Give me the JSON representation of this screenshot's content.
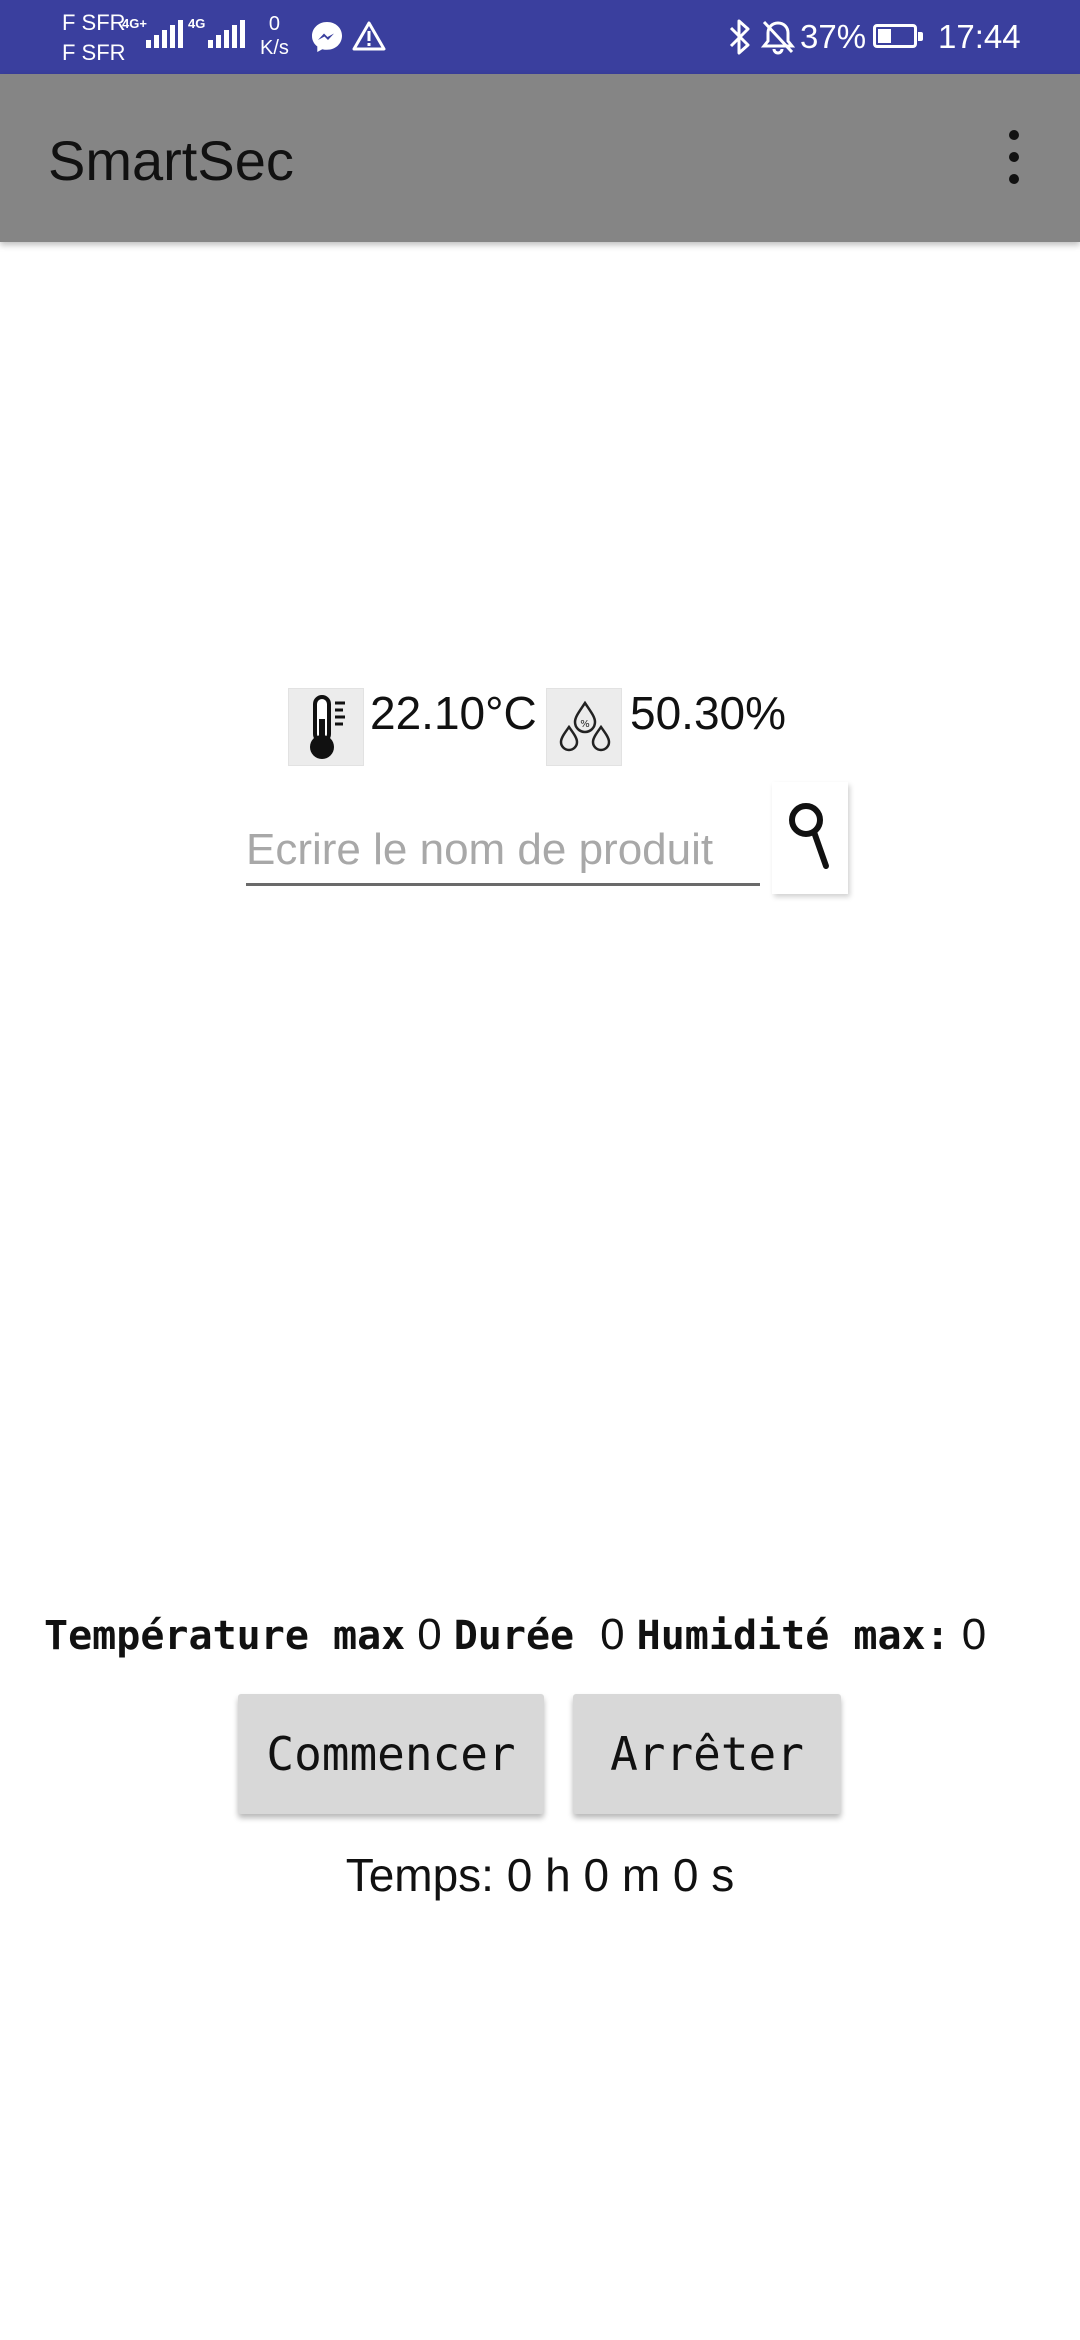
{
  "status_bar": {
    "carrier_1": "F SFR",
    "carrier_2": "F SFR",
    "network_1": "4G+",
    "network_2": "4G",
    "speed_value": "0",
    "speed_unit": "K/s",
    "battery_percent": "37%",
    "battery_level": 0.37,
    "time": "17:44",
    "icons": [
      "messenger-icon",
      "warning-icon",
      "bluetooth-icon",
      "bell-off-icon",
      "battery-icon"
    ]
  },
  "app_bar": {
    "title": "SmartSec",
    "menu_icon": "overflow-menu-icon"
  },
  "sensors": {
    "temperature": "22.10°C",
    "humidity": "50.30%",
    "temperature_icon": "thermometer-icon",
    "humidity_icon": "humidity-drops-icon"
  },
  "search": {
    "placeholder": "Ecrire le nom de produit",
    "value": "",
    "icon": "search-icon"
  },
  "parameters": {
    "temp_max_label": "Température max",
    "temp_max_value": "0",
    "duration_label": "Durée",
    "duration_value": "0",
    "humidity_max_label": "Humidité max:",
    "humidity_max_value": "0"
  },
  "buttons": {
    "start_label": "Commencer",
    "stop_label": "Arrêter"
  },
  "timer": {
    "text": "Temps: 0 h 0 m 0 s"
  }
}
